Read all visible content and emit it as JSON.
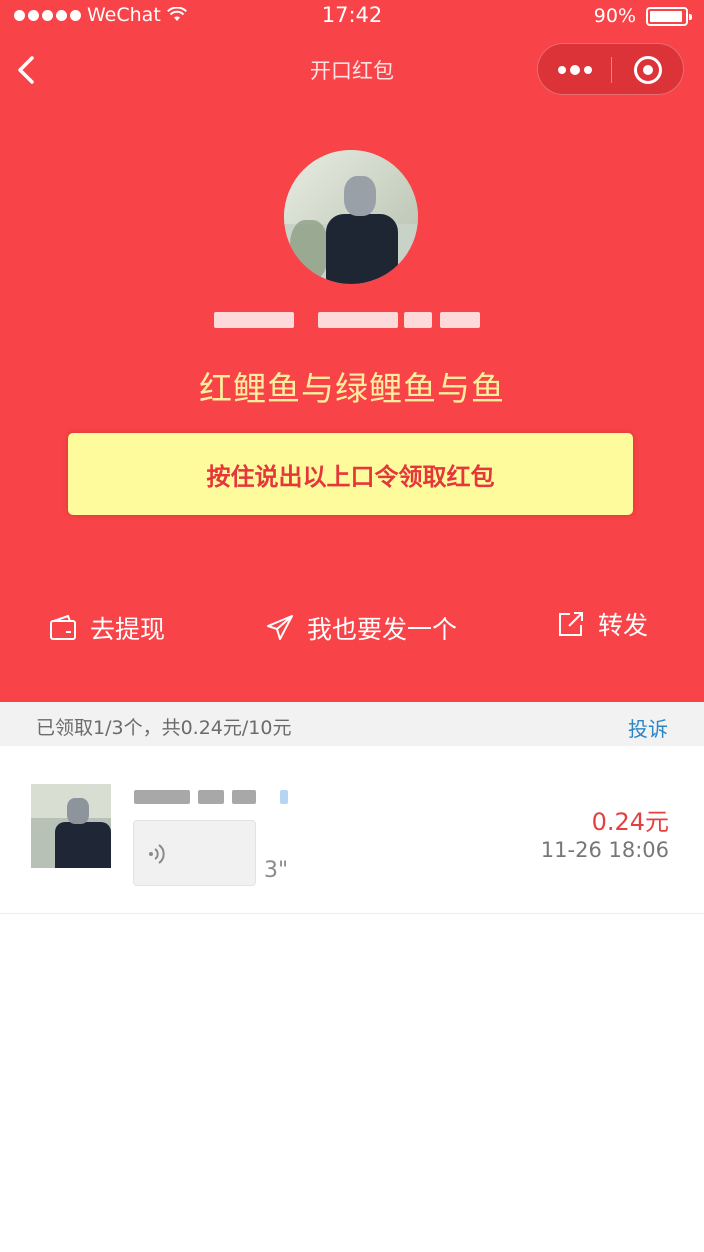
{
  "status_bar": {
    "carrier": "WeChat",
    "time": "17:42",
    "battery_text": "90%",
    "battery_level": 0.9
  },
  "nav": {
    "title": "开口红包"
  },
  "packet": {
    "password": "红鲤鱼与绿鲤鱼与鱼",
    "hold_button_label": "按住说出以上口令领取红包"
  },
  "actions": {
    "withdraw": "去提现",
    "send_one": "我也要发一个",
    "share": "转发"
  },
  "summary": {
    "text": "已领取1/3个，共0.24元/10元",
    "complain": "投诉"
  },
  "records": [
    {
      "voice_duration": "3\"",
      "amount": "0.24元",
      "time": "11-26 18:06"
    }
  ],
  "colors": {
    "header_red": "#f84448",
    "password_yellow": "#ffee9e",
    "button_yellow": "#fefb9d",
    "button_text_red": "#e5363c",
    "amount_red": "#e54040",
    "link_blue": "#2b86c6"
  }
}
